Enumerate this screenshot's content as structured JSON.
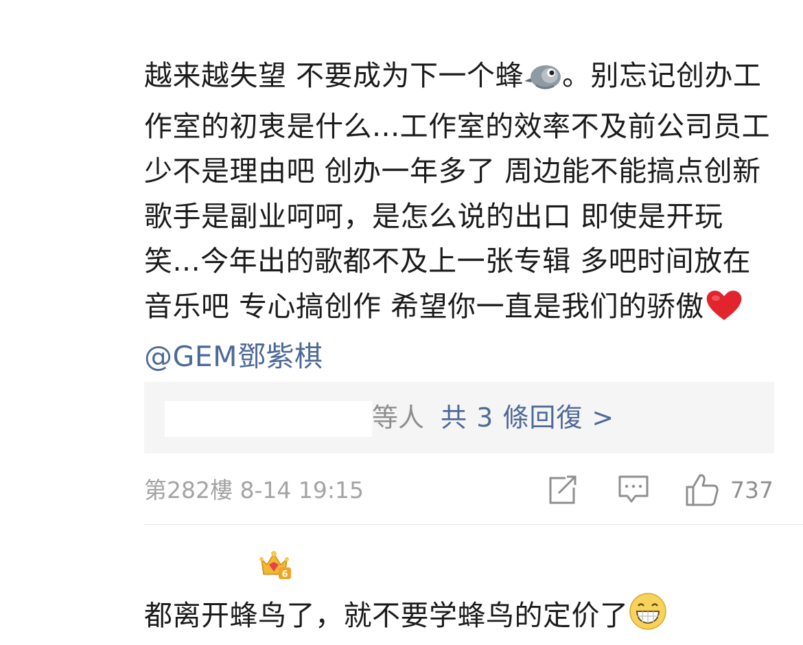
{
  "comment_1": {
    "text": "越来越失望 不要成为下一个蜂",
    "after_bird": "。别忘记创办工作室的初衷是什么...工作室的效率不及前公司员工少不是理由吧 创办一年多了 周边能不能搞点创新 歌手是副业呵呵，是怎么说的出口 即使是开玩笑...今年出的歌都不及上一张专辑  多吧时间放在音乐吧 专心搞创作   希望你一直是我们的骄傲",
    "emoji_bird": "bird-emoji",
    "emoji_heart": "heart-emoji",
    "mention": "@GEM鄧紫棋"
  },
  "replies": {
    "others": "等人",
    "link": "共 3 條回復 >"
  },
  "meta": {
    "floor": "第282樓 8-14 19:15",
    "like_count": "737",
    "icons": [
      "share-icon",
      "comment-icon",
      "like-icon"
    ]
  },
  "comment_2": {
    "badge_icon": "crown-level-badge-icon",
    "badge_level": "6",
    "text": "都离开蜂鸟了，就不要学蜂鸟的定价了",
    "emoji": "grin-emoji"
  },
  "colors": {
    "link_blue": "#4d6a97",
    "meta_gray": "#a3a3a3",
    "reply_bg": "#f5f5f5"
  }
}
